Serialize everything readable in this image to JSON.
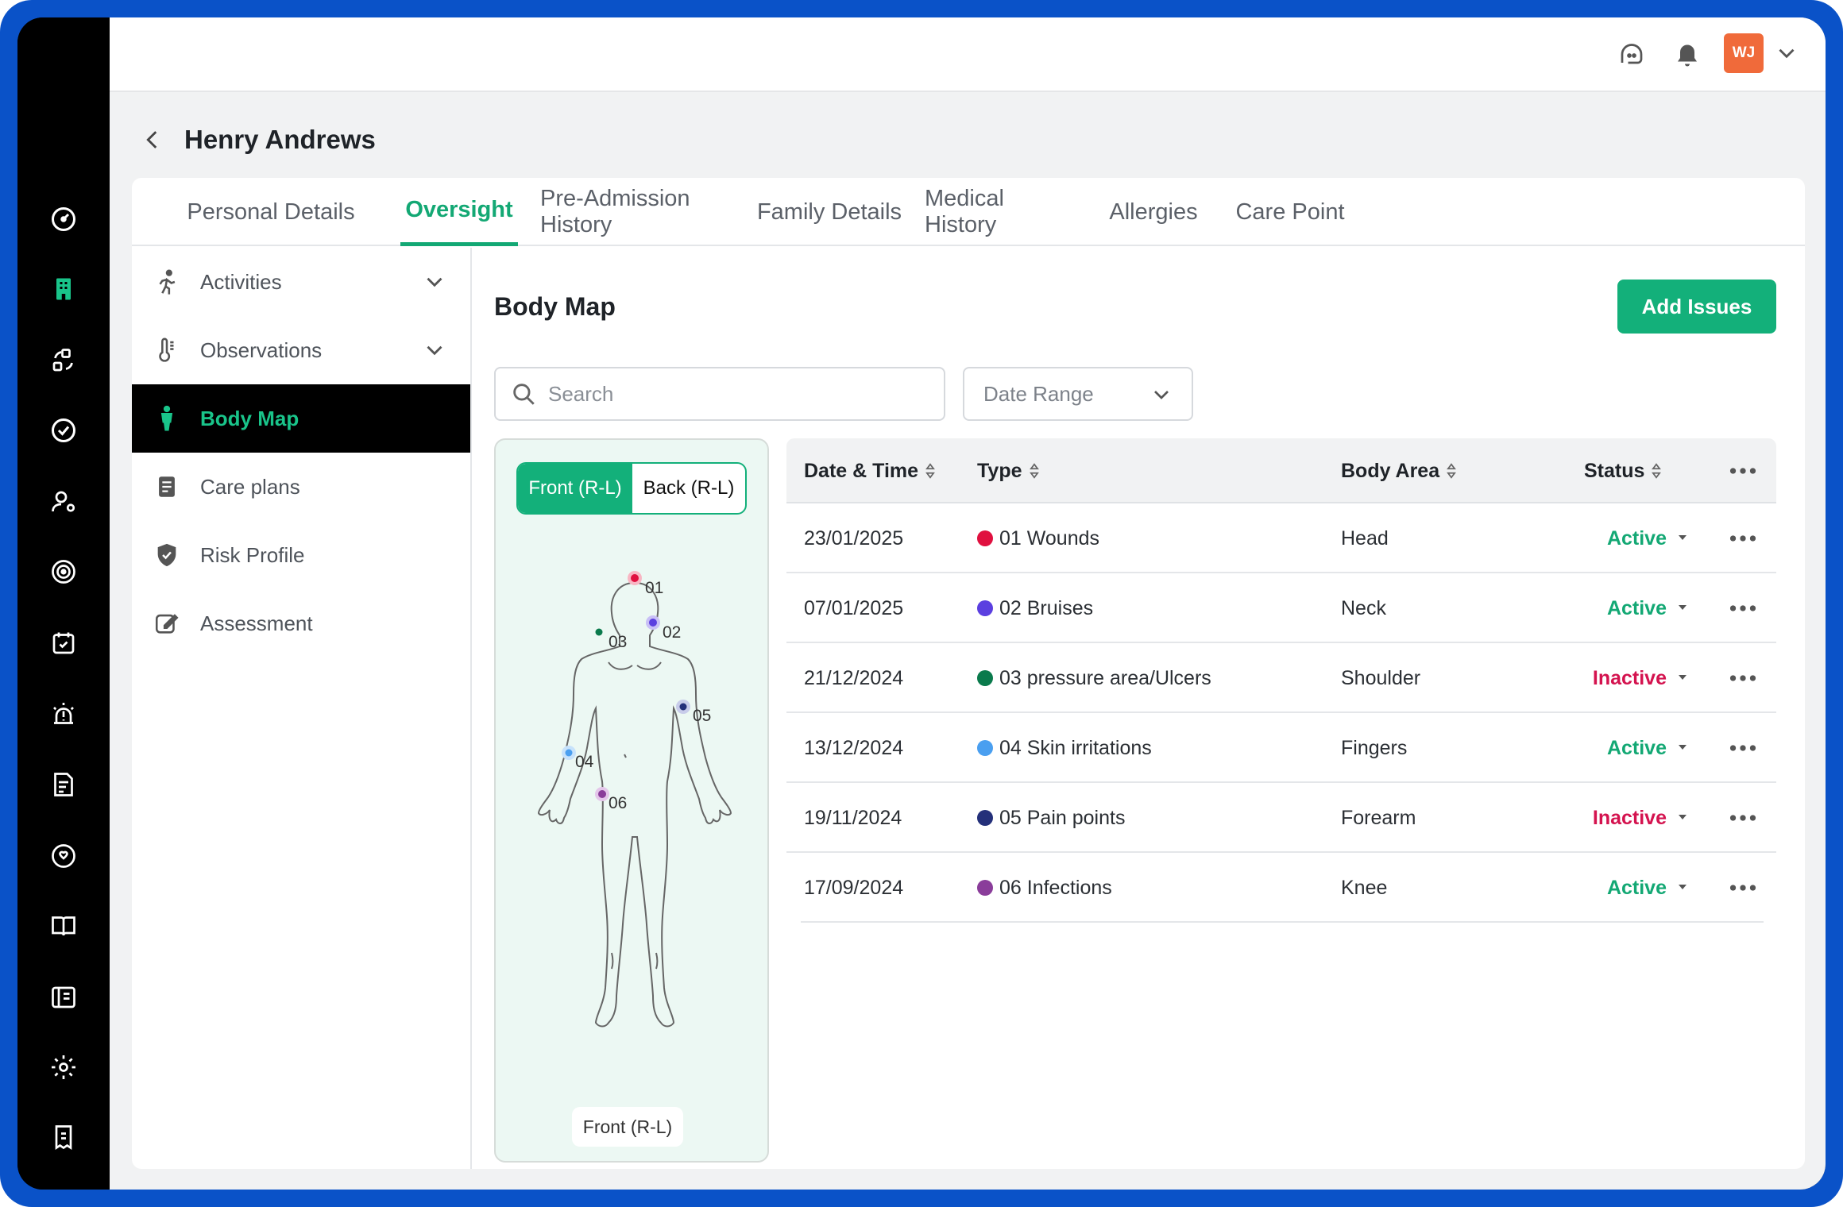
{
  "header": {
    "avatar_initials": "WJ"
  },
  "page": {
    "title": "Henry Andrews"
  },
  "tabs": [
    {
      "label": "Personal Details"
    },
    {
      "label": "Oversight"
    },
    {
      "label": "Pre-Admission  History"
    },
    {
      "label": "Family Details"
    },
    {
      "label": "Medical History"
    },
    {
      "label": "Allergies"
    },
    {
      "label": "Care Point"
    }
  ],
  "sidebar": {
    "items": [
      {
        "label": "Activities",
        "icon": "running-person-icon"
      },
      {
        "label": "Observations",
        "icon": "thermometer-icon"
      },
      {
        "label": "Body Map",
        "icon": "standing-person-icon"
      },
      {
        "label": "Care plans",
        "icon": "clipboard-list-icon"
      },
      {
        "label": "Risk Profile",
        "icon": "shield-check-icon"
      },
      {
        "label": "Assessment",
        "icon": "edit-pencil-icon"
      }
    ]
  },
  "main": {
    "section_title": "Body Map",
    "add_button": "Add Issues",
    "search_placeholder": "Search",
    "date_range": "Date Range"
  },
  "body_map": {
    "toggle_front": "Front (R-L)",
    "toggle_back": "Back (R-L)",
    "caption": "Front (R-L)",
    "markers": [
      "01",
      "02",
      "03",
      "04",
      "05",
      "06"
    ]
  },
  "table": {
    "headers": {
      "date": "Date & Time",
      "type": "Type",
      "area": "Body Area",
      "status": "Status"
    },
    "rows": [
      {
        "date": "23/01/2025",
        "type": "01 Wounds",
        "color": "#e0103f",
        "area": "Head",
        "status": "Active"
      },
      {
        "date": "07/01/2025",
        "type": "02 Bruises",
        "color": "#5b3fe0",
        "area": "Neck",
        "status": "Active"
      },
      {
        "date": "21/12/2024",
        "type": "03 pressure area/Ulcers",
        "color": "#0a7a4c",
        "area": "Shoulder",
        "status": "Inactive"
      },
      {
        "date": "13/12/2024",
        "type": "04 Skin irritations",
        "color": "#4a9ff0",
        "area": "Fingers",
        "status": "Active"
      },
      {
        "date": "19/11/2024",
        "type": "05 Pain points",
        "color": "#24307a",
        "area": "Forearm",
        "status": "Inactive"
      },
      {
        "date": "17/09/2024",
        "type": "06 Infections",
        "color": "#8a3d9a",
        "area": "Knee",
        "status": "Active"
      }
    ]
  },
  "colors": {
    "accent": "#13b07a",
    "active": "#13a874",
    "inactive": "#d4134f",
    "frame": "#0a52c8"
  }
}
